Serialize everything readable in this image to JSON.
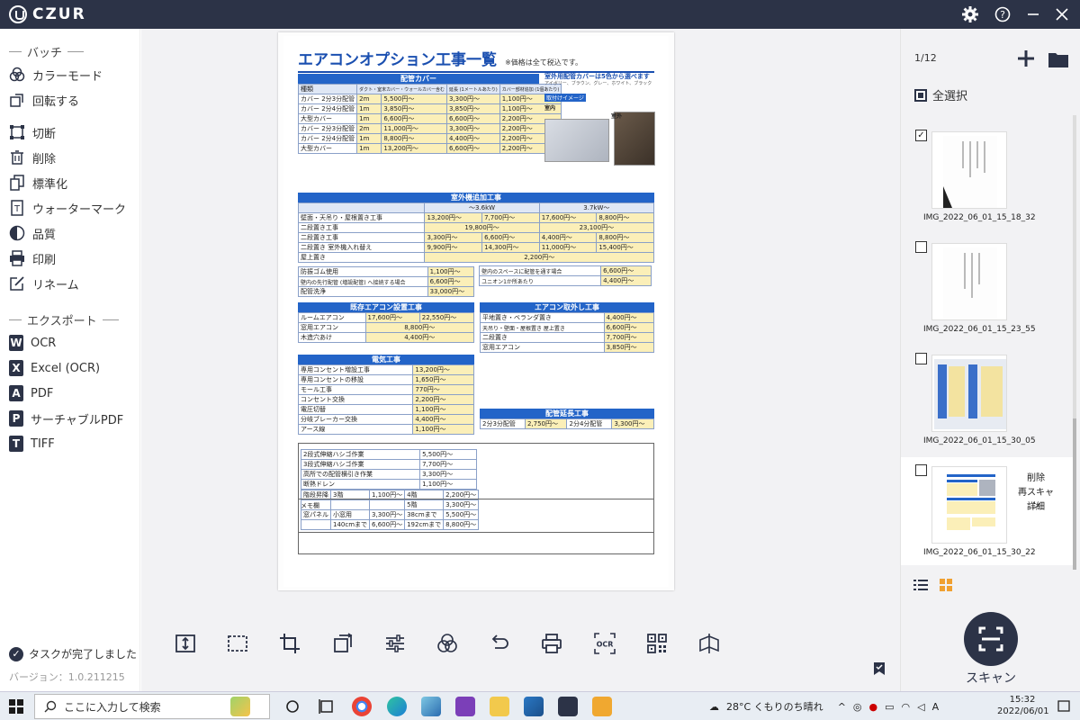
{
  "app": {
    "brand": "CZUR",
    "brand_color": "#2c3347"
  },
  "sidebar": {
    "batch_header": "バッチ",
    "tools": [
      {
        "label": "カラーモード",
        "icon": "color-mode-icon"
      },
      {
        "label": "回転する",
        "icon": "rotate-icon"
      },
      {
        "label": "切断",
        "icon": "cut-icon"
      },
      {
        "label": "削除",
        "icon": "trash-icon"
      },
      {
        "label": "標準化",
        "icon": "standardize-icon"
      },
      {
        "label": "ウォーターマーク",
        "icon": "watermark-icon"
      },
      {
        "label": "品質",
        "icon": "quality-icon"
      },
      {
        "label": "印刷",
        "icon": "print-icon"
      },
      {
        "label": "リネーム",
        "icon": "rename-icon"
      }
    ],
    "export_header": "エクスポート",
    "exports": [
      {
        "label": "OCR",
        "badge": "W"
      },
      {
        "label": "Excel (OCR)",
        "badge": "X"
      },
      {
        "label": "PDF",
        "badge": "A"
      },
      {
        "label": "サーチャブルPDF",
        "badge": "P"
      },
      {
        "label": "TIFF",
        "badge": "T"
      }
    ],
    "task_status": "タスクが完了しました",
    "version": "バージョン：1.0.211215"
  },
  "document": {
    "title": "エアコンオプション工事一覧",
    "note": "※価格は全て税込です。",
    "section1": "配管カバー",
    "section1_right": "室外用配管カバーは5色から選べます",
    "section1_right_sub": "アイボリー、ブラウン、グレー、ホワイト、ブラック",
    "install_image": "取付けイメージ",
    "indoor": "室内",
    "outdoor": "室外",
    "col_kind": "種類",
    "col_duct": "ダクト・室末カバー・ウォールカバー含む",
    "col_ext": "延長 (1メートルあたり)",
    "col_add": "カバー部材追加 (1個あたり)",
    "cover_rows": [
      [
        "カバー 2分3分配管",
        "2m",
        "5,500円〜",
        "3,300円〜",
        "1,100円〜"
      ],
      [
        "カバー 2分4分配管",
        "1m",
        "3,850円〜",
        "3,850円〜",
        "1,100円〜"
      ],
      [
        "大型カバー",
        "1m",
        "6,600円〜",
        "6,600円〜",
        "2,200円〜"
      ],
      [
        "カバー 2分3分配管",
        "2m",
        "11,000円〜",
        "3,300円〜",
        "2,200円〜"
      ],
      [
        "カバー 2分4分配管",
        "1m",
        "8,800円〜",
        "4,400円〜",
        "2,200円〜"
      ],
      [
        "大型カバー",
        "1m",
        "13,200円〜",
        "6,600円〜",
        "2,200円〜"
      ]
    ],
    "section2": "室外機追加工事",
    "kw_low": "〜3.6kW",
    "kw_high": "3.7kW〜",
    "outdoor_rows": [
      [
        "壁面・天吊り・屋根置き工事",
        "13,200円〜",
        "7,700円〜",
        "17,600円〜",
        "8,800円〜"
      ],
      [
        "二段置き工事",
        "19,800円〜",
        "",
        "23,100円〜",
        ""
      ],
      [
        "二段置き工事",
        "3,300円〜",
        "6,600円〜",
        "4,400円〜",
        "8,800円〜"
      ],
      [
        "二段置き 室外機入れ替え",
        "9,900円〜",
        "14,300円〜",
        "11,000円〜",
        "15,400円〜"
      ],
      [
        "屋上置き",
        "2,200円〜",
        "",
        "",
        ""
      ]
    ],
    "misc_rows": [
      [
        "防振ゴム使用",
        "1,100円〜"
      ],
      [
        "壁内の先行配管 (増設配管) へ接続する場合",
        "6,600円〜"
      ],
      [
        "配管洗浄",
        "33,000円〜"
      ]
    ],
    "misc_right_rows": [
      [
        "壁内のスペースに配管を通す場合",
        "6,600円〜"
      ],
      [
        "ユニオン1か所あたり",
        "4,400円〜"
      ]
    ],
    "section3": "既存エアコン設置工事",
    "existing_rows": [
      [
        "ルームエアコン",
        "17,600円〜",
        "22,550円〜"
      ],
      [
        "窓用エアコン",
        "8,800円〜",
        ""
      ],
      [
        "木造穴あけ",
        "4,400円〜",
        ""
      ]
    ],
    "section4": "エアコン取外し工事",
    "removal_rows": [
      [
        "平地置き・ベランダ置き",
        "4,400円〜"
      ],
      [
        "天吊り・壁面・屋根置き 屋上置き",
        "6,600円〜"
      ],
      [
        "二段置き",
        "7,700円〜"
      ],
      [
        "窓用エアコン",
        "3,850円〜"
      ]
    ],
    "section5": "電気工事",
    "electric_rows": [
      [
        "専用コンセント増設工事",
        "13,200円〜"
      ],
      [
        "専用コンセントの移設",
        "1,650円〜"
      ],
      [
        "モール工事",
        "770円〜"
      ],
      [
        "コンセント交換",
        "2,200円〜"
      ],
      [
        "電圧切替",
        "1,100円〜"
      ],
      [
        "分岐ブレーカー交換",
        "4,400円〜"
      ],
      [
        "アース線",
        "1,100円〜"
      ]
    ],
    "section6": "配管延長工事",
    "extension_rows": [
      [
        "2分3分配管",
        "2,750円〜",
        "2分4分配管",
        "3,300円〜"
      ]
    ],
    "bottom_rows": [
      [
        "2段式伸縮ハシゴ作業",
        "5,500円〜"
      ],
      [
        "3段式伸縮ハシゴ作業",
        "7,700円〜"
      ],
      [
        "高所での配管横引き作業",
        "3,300円〜"
      ],
      [
        "断熱ドレン",
        "1,100円〜"
      ]
    ],
    "bottom_right_rows": [
      [
        "階段昇降",
        "3階",
        "1,100円〜",
        "4階",
        "2,200円〜"
      ],
      [
        "",
        "",
        "",
        "5階",
        "3,300円〜"
      ],
      [
        "窓パネル",
        "小窓用",
        "3,300円〜",
        "38cmまで",
        "5,500円〜"
      ],
      [
        "",
        "140cmまで",
        "6,600円〜",
        "192cmまで",
        "8,800円〜"
      ]
    ],
    "memo": "メモ欄"
  },
  "toolbar": {
    "tools": [
      "fit-height-icon",
      "select-area-icon",
      "crop-icon",
      "rotate-page-icon",
      "adjust-icon",
      "color-icon",
      "undo-icon",
      "print-icon",
      "ocr-icon",
      "qr-icon",
      "bookmark-icon"
    ],
    "ocr_label": "OCR"
  },
  "right_panel": {
    "page_count": "1/12",
    "select_all": "全選択",
    "thumbnails": [
      {
        "name": "IMG_2022_06_01_15_18_32",
        "checked": true
      },
      {
        "name": "IMG_2022_06_01_15_23_55",
        "checked": false
      },
      {
        "name": "IMG_2022_06_01_15_30_05",
        "checked": false
      },
      {
        "name": "IMG_2022_06_01_15_30_22",
        "checked": false
      }
    ],
    "context_menu": [
      "削除",
      "再スキャン",
      "詳細"
    ],
    "scan_label": "スキャン"
  },
  "taskbar": {
    "search_placeholder": "ここに入力して検索",
    "weather": "28°C くもりのち晴れ",
    "ime": "A",
    "time": "15:32",
    "date": "2022/06/01"
  }
}
